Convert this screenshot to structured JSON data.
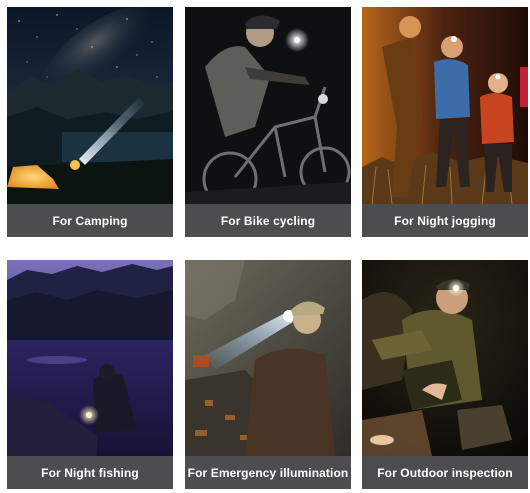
{
  "gallery": {
    "items": [
      {
        "caption": "For  Camping",
        "scene": "camping"
      },
      {
        "caption": "For  Bike cycling",
        "scene": "bike-cycling"
      },
      {
        "caption": "For  Night jogging",
        "scene": "night-jogging"
      },
      {
        "caption": "For Night fishing",
        "scene": "night-fishing"
      },
      {
        "caption": "For Emergency illumination",
        "scene": "emergency-illumination"
      },
      {
        "caption": "For  Outdoor inspection",
        "scene": "outdoor-inspection"
      }
    ]
  },
  "colors": {
    "caption_bg": "#4d4d4f",
    "caption_text": "#ffffff",
    "page_bg": "#ffffff"
  }
}
